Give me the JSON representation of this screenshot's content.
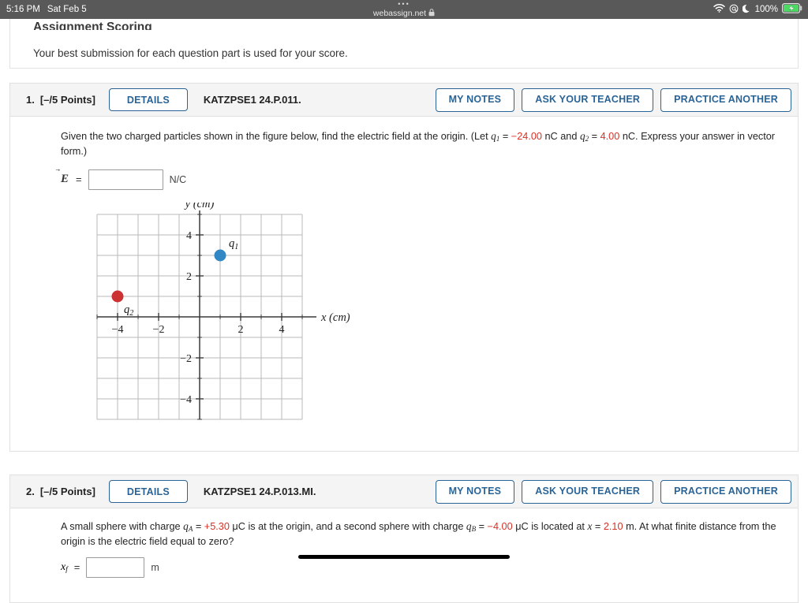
{
  "statusbar": {
    "time": "5:16 PM",
    "date": "Sat Feb 5",
    "dots": "•••",
    "url": "webassign.net",
    "lock_icon": "lock-icon",
    "wifi_icon": "wifi-icon",
    "at_icon": "at-symbol-icon",
    "dnd_icon": "moon-icon",
    "battery_percent": "100%",
    "battery_icon": "battery-charging-icon",
    "bg_color": "#595959",
    "battery_color": "#4cd964"
  },
  "assignment": {
    "title": "Assignment Scoring",
    "subtitle": "Your best submission for each question part is used for your score."
  },
  "buttons": {
    "details": "DETAILS",
    "my_notes": "MY NOTES",
    "ask_your_teacher": "ASK YOUR TEACHER",
    "practice_another": "PRACTICE ANOTHER",
    "accent_color": "#2a6496"
  },
  "questions": [
    {
      "number": "1.",
      "points": "[–/5 Points]",
      "code": "KATZPSE1 24.P.011.",
      "prompt_part1": "Given the two charged particles shown in the figure below, find the electric field at the origin. (Let",
      "q1_symbol": "q",
      "q1_sub": "1",
      "q1_value": "−24.00",
      "q1_unit": "nC",
      "conjunction": "and",
      "q2_symbol": "q",
      "q2_sub": "2",
      "q2_value": "4.00",
      "q2_unit": "nC.",
      "prompt_part2": "Express your answer in vector form.)",
      "answer_label": "E",
      "answer_vector_mark": "⃗",
      "answer_equals": "=",
      "answer_value": "",
      "answer_placeholder": "",
      "answer_unit": "N/C"
    },
    {
      "number": "2.",
      "points": "[–/5 Points]",
      "code": "KATZPSE1 24.P.013.MI.",
      "prompt_part1": "A small sphere with charge",
      "qa_symbol": "q",
      "qa_sub": "A",
      "qa_value": "+5.30",
      "qa_unit": "μC",
      "prompt_part2": "is at the origin, and a second sphere with charge",
      "qb_symbol": "q",
      "qb_sub": "B",
      "qb_value": "−4.00",
      "qb_unit": "μC",
      "prompt_part3": "is located at",
      "x_symbol": "x",
      "x_equals": "=",
      "x_value": "2.10",
      "x_unit": "m.",
      "prompt_part4": "At what finite distance from the origin is the electric field equal to zero?",
      "answer_label": "x",
      "answer_sub": "f",
      "answer_equals": "=",
      "answer_value": "",
      "answer_unit": "m"
    }
  ],
  "chart_data": {
    "type": "scatter",
    "title": "",
    "xlabel": "x  (cm)",
    "ylabel": "y  (cm)",
    "xlim": [
      -5,
      5
    ],
    "ylim": [
      -5,
      5
    ],
    "xticks": [
      -4,
      -2,
      2,
      4
    ],
    "yticks": [
      -4,
      -2,
      2,
      4
    ],
    "xtick_labels": [
      "−4",
      "−2",
      "2",
      "4"
    ],
    "ytick_labels": [
      "−4",
      "−2",
      "2",
      "4"
    ],
    "grid": true,
    "grid_spacing": 1,
    "grid_color": "#b8b8b8",
    "axis_color": "#3a3a3a",
    "points": [
      {
        "label": "q",
        "sub": "1",
        "x": 1,
        "y": 3,
        "color": "#3288c4",
        "label_dx": 0.35,
        "label_dy": 0.75
      },
      {
        "label": "q",
        "sub": "2",
        "x": -4,
        "y": 1,
        "color": "#cc3232",
        "label_dx": 0.2,
        "label_dy": -0.85
      }
    ]
  }
}
